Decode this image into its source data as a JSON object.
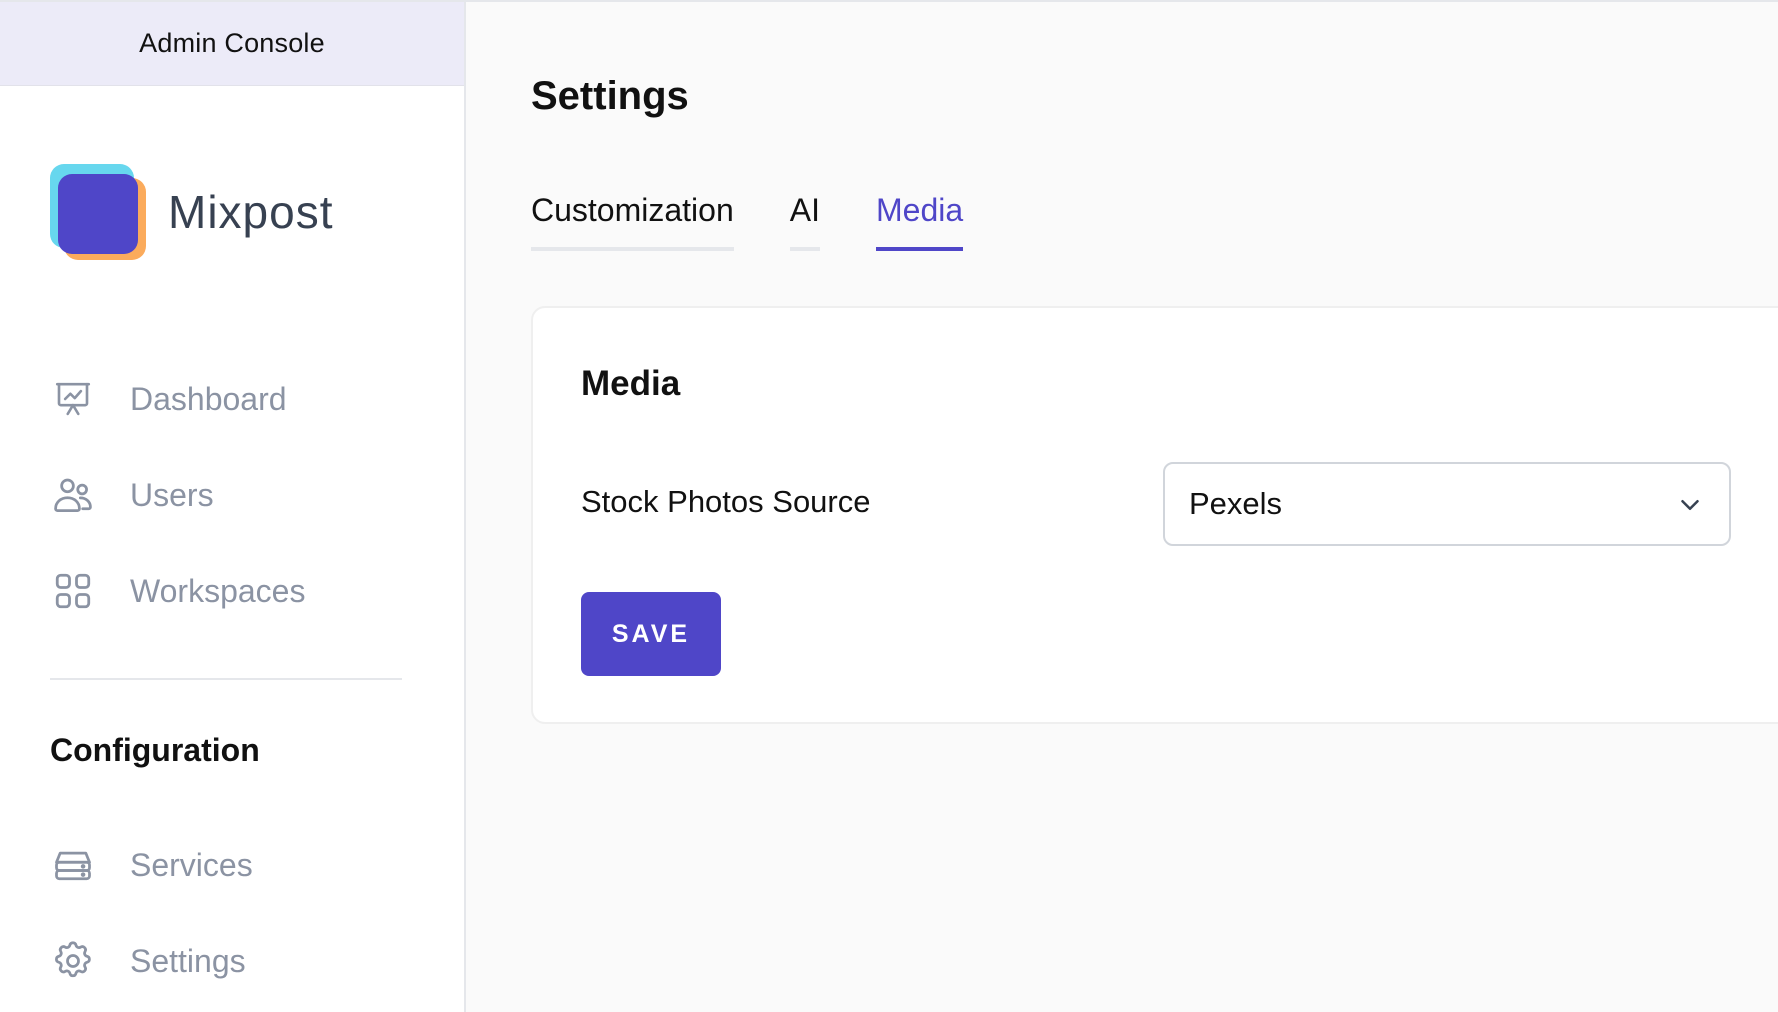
{
  "sidebar": {
    "console_label": "Admin Console",
    "brand_name": "Mixpost",
    "nav_items": [
      {
        "label": "Dashboard",
        "icon": "presentation-chart-icon"
      },
      {
        "label": "Users",
        "icon": "users-icon"
      },
      {
        "label": "Workspaces",
        "icon": "grid-icon"
      }
    ],
    "section_title": "Configuration",
    "config_items": [
      {
        "label": "Services",
        "icon": "server-icon"
      },
      {
        "label": "Settings",
        "icon": "gear-icon"
      }
    ]
  },
  "main": {
    "page_title": "Settings",
    "tabs": [
      {
        "label": "Customization",
        "active": false
      },
      {
        "label": "AI",
        "active": false
      },
      {
        "label": "Media",
        "active": true
      }
    ],
    "card": {
      "title": "Media",
      "field_label": "Stock Photos Source",
      "select_value": "Pexels",
      "save_label": "SAVE"
    }
  },
  "colors": {
    "accent": "#4f46c8",
    "nav_text": "#8b93a3",
    "console_bar": "#ecebf8"
  }
}
